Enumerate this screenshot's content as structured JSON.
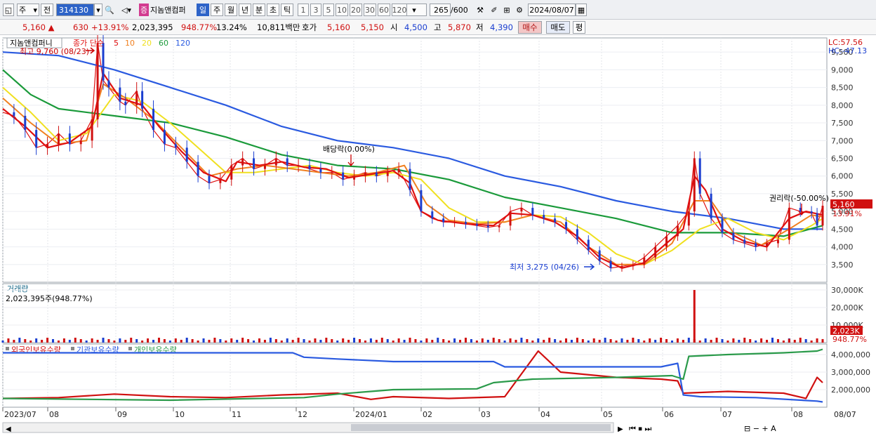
{
  "toolbar": {
    "unit": "주",
    "market": "전",
    "code": "314130",
    "stock_badge": "증",
    "stock_name": "지놈앤컴퍼",
    "periods": [
      "일",
      "주",
      "월",
      "년",
      "분",
      "초",
      "틱"
    ],
    "active_period": "일",
    "intervals": [
      "1",
      "3",
      "5",
      "10",
      "20",
      "30",
      "60",
      "120"
    ],
    "count": "265",
    "count_total": "/600",
    "date": "2024/08/07"
  },
  "info": {
    "price": "5,160",
    "change": "630",
    "change_pct": "+13.91%",
    "volume": "2,023,395",
    "volume_ratio": "948.77%",
    "turnover": "13.24%",
    "amount": "10,811백만",
    "quote_label": "호가",
    "ask": "5,160",
    "bid": "5,150",
    "open_label": "시",
    "open": "4,500",
    "high_label": "고",
    "high": "5,870",
    "low_label": "저",
    "low": "4,390",
    "buy_label": "매수",
    "sell_label": "매도",
    "eval_label": "평"
  },
  "legend": {
    "name": "지놈앤컴퍼니",
    "ma_label": "종가 단순",
    "ma_periods": [
      "5",
      "10",
      "20",
      "60",
      "120"
    ],
    "lc": "LC:57.56",
    "hc": "HC:-47.13",
    "volume_title": "거래량",
    "volume_value": "2,023,395주(948.77%)",
    "holding_series": [
      "외국인보유수량",
      "기관보유수량",
      "개인보유수량"
    ]
  },
  "annotations": {
    "high": "최고 9,760 (08/23)",
    "low": "최저 3,275 (04/26)",
    "dividend": "배당락(0.00%)",
    "rights": "권리락(-50.00%)",
    "price_tag": "5,160",
    "pct_tag": "13.91%",
    "vol_tag": "2,023K",
    "vol_pct_tag": "948.77%"
  },
  "colors": {
    "up": "#d01010",
    "down": "#1a3ed0",
    "ma5": "#e01010",
    "ma10": "#f08020",
    "ma20": "#f0e020",
    "ma60": "#1a9a3a",
    "ma120": "#2a5ae0",
    "foreign": "#d01010",
    "institution": "#2a5ae0",
    "individual": "#2a9a4a"
  },
  "chart_data": {
    "type": "line",
    "x_labels": [
      "2023/07",
      "08",
      "09",
      "10",
      "11",
      "12",
      "2024/01",
      "02",
      "03",
      "04",
      "05",
      "06",
      "07",
      "08"
    ],
    "price_axis": {
      "ylim": [
        3000,
        9900
      ],
      "ticks": [
        3500,
        4000,
        4500,
        5000,
        5500,
        6000,
        6500,
        7000,
        7500,
        8000,
        8500,
        9000,
        9500
      ]
    },
    "volume_axis": {
      "ylim": [
        0,
        32000
      ],
      "ticks_label": [
        "10,000K",
        "20,000K",
        "30,000K"
      ],
      "ticks": [
        10000,
        20000,
        30000
      ]
    },
    "holding_axis": {
      "ylim": [
        1000000,
        4600000
      ],
      "ticks_label": [
        "2,000,000",
        "3,000,000",
        "4,000,000"
      ],
      "ticks": [
        2000000,
        3000000,
        4000000
      ]
    },
    "price_series": [
      {
        "name": "종가",
        "points": [
          [
            0,
            7800
          ],
          [
            2,
            7700
          ],
          [
            4,
            7300
          ],
          [
            6,
            6800
          ],
          [
            8,
            6900
          ],
          [
            10,
            7200
          ],
          [
            12,
            6900
          ],
          [
            14,
            7000
          ],
          [
            16,
            7600
          ],
          [
            17,
            9760
          ],
          [
            18,
            8700
          ],
          [
            19,
            8500
          ],
          [
            21,
            8100
          ],
          [
            22,
            8000
          ],
          [
            24,
            8400
          ],
          [
            25,
            7900
          ],
          [
            27,
            7300
          ],
          [
            29,
            6900
          ],
          [
            31,
            6800
          ],
          [
            33,
            6400
          ],
          [
            35,
            6000
          ],
          [
            37,
            5800
          ],
          [
            39,
            5900
          ],
          [
            41,
            6300
          ],
          [
            43,
            6500
          ],
          [
            45,
            6200
          ],
          [
            47,
            6300
          ],
          [
            49,
            6500
          ],
          [
            51,
            6300
          ],
          [
            53,
            6300
          ],
          [
            55,
            6200
          ],
          [
            57,
            6100
          ],
          [
            59,
            6100
          ],
          [
            61,
            5900
          ],
          [
            63,
            6000
          ],
          [
            65,
            6100
          ],
          [
            67,
            6000
          ],
          [
            69,
            6100
          ],
          [
            71,
            6200
          ],
          [
            73,
            5600
          ],
          [
            75,
            5000
          ],
          [
            77,
            4800
          ],
          [
            79,
            4700
          ],
          [
            81,
            4700
          ],
          [
            83,
            4650
          ],
          [
            85,
            4600
          ],
          [
            87,
            4550
          ],
          [
            89,
            4600
          ],
          [
            91,
            5000
          ],
          [
            93,
            5100
          ],
          [
            95,
            4900
          ],
          [
            97,
            4800
          ],
          [
            99,
            4700
          ],
          [
            101,
            4500
          ],
          [
            103,
            4200
          ],
          [
            105,
            3900
          ],
          [
            107,
            3600
          ],
          [
            109,
            3400
          ],
          [
            111,
            3450
          ],
          [
            113,
            3500
          ],
          [
            115,
            3700
          ],
          [
            117,
            4000
          ],
          [
            119,
            4300
          ],
          [
            121,
            4600
          ],
          [
            123,
            5000
          ],
          [
            124,
            6500
          ],
          [
            125,
            5500
          ],
          [
            127,
            4800
          ],
          [
            129,
            4400
          ],
          [
            131,
            4200
          ],
          [
            133,
            4100
          ],
          [
            135,
            4000
          ],
          [
            137,
            4100
          ],
          [
            139,
            4200
          ],
          [
            141,
            5100
          ],
          [
            143,
            5000
          ],
          [
            145,
            4950
          ],
          [
            146,
            4600
          ],
          [
            147,
            5160
          ]
        ]
      },
      {
        "name": "120",
        "points": [
          [
            0,
            9500
          ],
          [
            10,
            9400
          ],
          [
            20,
            9000
          ],
          [
            30,
            8500
          ],
          [
            40,
            8000
          ],
          [
            50,
            7400
          ],
          [
            60,
            7000
          ],
          [
            70,
            6800
          ],
          [
            80,
            6500
          ],
          [
            90,
            6000
          ],
          [
            100,
            5700
          ],
          [
            110,
            5300
          ],
          [
            120,
            5000
          ],
          [
            130,
            4800
          ],
          [
            140,
            4500
          ],
          [
            147,
            4500
          ]
        ]
      },
      {
        "name": "60",
        "points": [
          [
            0,
            9000
          ],
          [
            5,
            8300
          ],
          [
            10,
            7900
          ],
          [
            20,
            7700
          ],
          [
            30,
            7500
          ],
          [
            40,
            7100
          ],
          [
            50,
            6600
          ],
          [
            60,
            6300
          ],
          [
            70,
            6200
          ],
          [
            80,
            5900
          ],
          [
            90,
            5400
          ],
          [
            100,
            5100
          ],
          [
            110,
            4800
          ],
          [
            120,
            4400
          ],
          [
            130,
            4400
          ],
          [
            140,
            4300
          ],
          [
            147,
            4600
          ]
        ]
      },
      {
        "name": "20",
        "points": [
          [
            0,
            8500
          ],
          [
            5,
            7800
          ],
          [
            10,
            7000
          ],
          [
            15,
            7200
          ],
          [
            20,
            8300
          ],
          [
            25,
            8100
          ],
          [
            30,
            7500
          ],
          [
            35,
            6800
          ],
          [
            40,
            6100
          ],
          [
            45,
            6100
          ],
          [
            50,
            6200
          ],
          [
            55,
            6300
          ],
          [
            60,
            6100
          ],
          [
            65,
            6000
          ],
          [
            70,
            6100
          ],
          [
            75,
            5900
          ],
          [
            80,
            5100
          ],
          [
            85,
            4700
          ],
          [
            90,
            4700
          ],
          [
            95,
            4900
          ],
          [
            100,
            4850
          ],
          [
            105,
            4400
          ],
          [
            110,
            3800
          ],
          [
            115,
            3500
          ],
          [
            120,
            3900
          ],
          [
            125,
            4500
          ],
          [
            130,
            4800
          ],
          [
            135,
            4400
          ],
          [
            140,
            4200
          ],
          [
            145,
            4600
          ],
          [
            147,
            4800
          ]
        ]
      },
      {
        "name": "10",
        "points": [
          [
            0,
            8200
          ],
          [
            5,
            7500
          ],
          [
            10,
            6900
          ],
          [
            15,
            7000
          ],
          [
            18,
            8600
          ],
          [
            22,
            8200
          ],
          [
            27,
            7600
          ],
          [
            32,
            6800
          ],
          [
            37,
            6000
          ],
          [
            42,
            6200
          ],
          [
            47,
            6300
          ],
          [
            52,
            6200
          ],
          [
            57,
            6100
          ],
          [
            62,
            6000
          ],
          [
            67,
            6100
          ],
          [
            72,
            6300
          ],
          [
            76,
            5200
          ],
          [
            80,
            4750
          ],
          [
            85,
            4650
          ],
          [
            90,
            4700
          ],
          [
            95,
            4900
          ],
          [
            100,
            4700
          ],
          [
            105,
            4000
          ],
          [
            110,
            3500
          ],
          [
            115,
            3500
          ],
          [
            120,
            4100
          ],
          [
            124,
            5300
          ],
          [
            127,
            5300
          ],
          [
            131,
            4400
          ],
          [
            136,
            4050
          ],
          [
            141,
            4500
          ],
          [
            145,
            4900
          ],
          [
            147,
            4850
          ]
        ]
      },
      {
        "name": "5",
        "points": [
          [
            0,
            7900
          ],
          [
            4,
            7400
          ],
          [
            8,
            6800
          ],
          [
            12,
            6950
          ],
          [
            16,
            7400
          ],
          [
            18,
            8900
          ],
          [
            21,
            8200
          ],
          [
            25,
            8000
          ],
          [
            28,
            7400
          ],
          [
            32,
            6700
          ],
          [
            36,
            6100
          ],
          [
            40,
            5850
          ],
          [
            42,
            6400
          ],
          [
            46,
            6300
          ],
          [
            50,
            6400
          ],
          [
            54,
            6250
          ],
          [
            58,
            6200
          ],
          [
            62,
            5950
          ],
          [
            66,
            6050
          ],
          [
            70,
            6150
          ],
          [
            73,
            5800
          ],
          [
            75,
            5000
          ],
          [
            78,
            4750
          ],
          [
            83,
            4650
          ],
          [
            88,
            4600
          ],
          [
            91,
            4950
          ],
          [
            95,
            4900
          ],
          [
            99,
            4700
          ],
          [
            103,
            4300
          ],
          [
            107,
            3700
          ],
          [
            111,
            3400
          ],
          [
            115,
            3550
          ],
          [
            119,
            4100
          ],
          [
            122,
            4500
          ],
          [
            124,
            6000
          ],
          [
            126,
            5600
          ],
          [
            129,
            4500
          ],
          [
            133,
            4150
          ],
          [
            137,
            4000
          ],
          [
            141,
            4800
          ],
          [
            144,
            5000
          ],
          [
            147,
            4900
          ]
        ]
      }
    ],
    "volume_spikes": [
      [
        124,
        30000
      ],
      [
        141,
        2200
      ],
      [
        147,
        2023
      ]
    ],
    "holding_series": [
      {
        "name": "외국인보유수량",
        "points": [
          [
            0,
            1500000
          ],
          [
            10,
            1550000
          ],
          [
            20,
            1750000
          ],
          [
            30,
            1600000
          ],
          [
            40,
            1550000
          ],
          [
            50,
            1700000
          ],
          [
            60,
            1800000
          ],
          [
            66,
            1450000
          ],
          [
            70,
            1600000
          ],
          [
            80,
            1500000
          ],
          [
            90,
            1600000
          ],
          [
            96,
            4200000
          ],
          [
            100,
            3000000
          ],
          [
            110,
            2700000
          ],
          [
            118,
            2600000
          ],
          [
            121,
            2500000
          ],
          [
            122,
            1800000
          ],
          [
            130,
            1900000
          ],
          [
            140,
            1800000
          ],
          [
            144,
            1500000
          ],
          [
            146,
            2700000
          ],
          [
            147,
            2400000
          ]
        ]
      },
      {
        "name": "기관보유수량",
        "points": [
          [
            0,
            4100000
          ],
          [
            40,
            4100000
          ],
          [
            52,
            4100000
          ],
          [
            54,
            3850000
          ],
          [
            60,
            3750000
          ],
          [
            70,
            3600000
          ],
          [
            88,
            3600000
          ],
          [
            90,
            3300000
          ],
          [
            100,
            3300000
          ],
          [
            118,
            3300000
          ],
          [
            121,
            3500000
          ],
          [
            122,
            1700000
          ],
          [
            125,
            1600000
          ],
          [
            135,
            1550000
          ],
          [
            146,
            1350000
          ],
          [
            147,
            1300000
          ]
        ]
      },
      {
        "name": "개인보유수량",
        "points": [
          [
            0,
            1500000
          ],
          [
            30,
            1400000
          ],
          [
            54,
            1550000
          ],
          [
            60,
            1750000
          ],
          [
            70,
            2000000
          ],
          [
            85,
            2050000
          ],
          [
            88,
            2400000
          ],
          [
            95,
            2600000
          ],
          [
            110,
            2700000
          ],
          [
            120,
            2800000
          ],
          [
            122,
            2600000
          ],
          [
            123,
            3900000
          ],
          [
            130,
            4000000
          ],
          [
            140,
            4100000
          ],
          [
            146,
            4200000
          ],
          [
            147,
            4300000
          ]
        ]
      }
    ]
  }
}
